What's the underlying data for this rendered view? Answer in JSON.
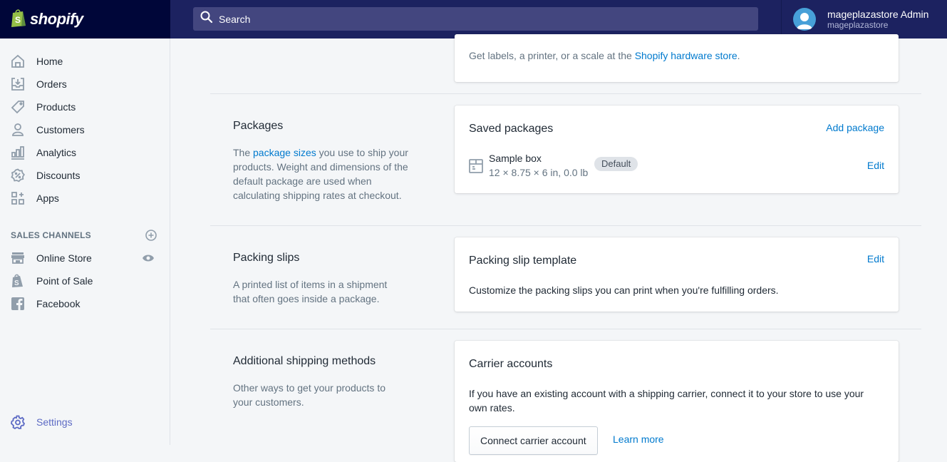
{
  "topbar": {
    "logo_text": "shopify",
    "search_placeholder": "Search",
    "user_name": "mageplazastore Admin",
    "store_name": "mageplazastore"
  },
  "sidebar": {
    "items": [
      {
        "label": "Home",
        "icon": "home-icon"
      },
      {
        "label": "Orders",
        "icon": "orders-icon"
      },
      {
        "label": "Products",
        "icon": "tag-icon"
      },
      {
        "label": "Customers",
        "icon": "person-icon"
      },
      {
        "label": "Analytics",
        "icon": "bar-chart-icon"
      },
      {
        "label": "Discounts",
        "icon": "discount-icon"
      },
      {
        "label": "Apps",
        "icon": "apps-icon"
      }
    ],
    "channels_title": "SALES CHANNELS",
    "channels": [
      {
        "label": "Online Store",
        "icon": "store-icon"
      },
      {
        "label": "Point of Sale",
        "icon": "shopify-bag-icon"
      },
      {
        "label": "Facebook",
        "icon": "facebook-icon"
      }
    ],
    "settings_label": "Settings"
  },
  "main": {
    "hardware": {
      "text_before": "Get labels, a printer, or a scale at the ",
      "link": "Shopify hardware store",
      "text_after": "."
    },
    "packages": {
      "title": "Packages",
      "desc_before": "The ",
      "desc_link": "package sizes",
      "desc_after": " you use to ship your products. Weight and dimensions of the default package are used when calculating shipping rates at checkout.",
      "card_title": "Saved packages",
      "add_label": "Add package",
      "package_name": "Sample box",
      "package_dims": "12 × 8.75 × 6 in, 0.0 lb",
      "badge": "Default",
      "edit_label": "Edit"
    },
    "packing_slips": {
      "title": "Packing slips",
      "desc": "A printed list of items in a shipment that often goes inside a package.",
      "card_title": "Packing slip template",
      "edit_label": "Edit",
      "card_text": "Customize the packing slips you can print when you're fulfilling orders."
    },
    "additional": {
      "title": "Additional shipping methods",
      "desc": "Other ways to get your products to your customers.",
      "card_title": "Carrier accounts",
      "card_text": "If you have an existing account with a shipping carrier, connect it to your store to use your own rates.",
      "button_label": "Connect carrier account",
      "learn_more": "Learn more"
    }
  },
  "colors": {
    "topbar": "#1c2260",
    "logo_bg": "#000639",
    "search_bg": "#43467f",
    "link": "#007ace",
    "settings": "#5c6ac4"
  }
}
